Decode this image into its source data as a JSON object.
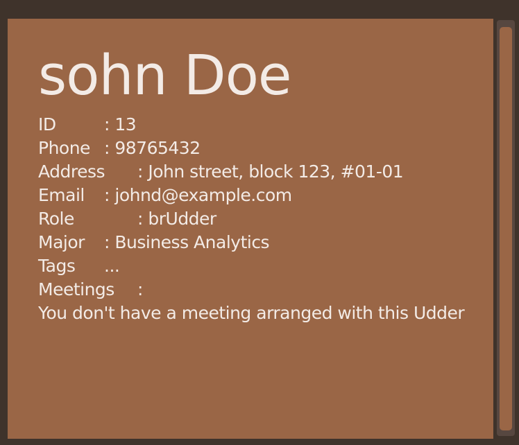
{
  "person": {
    "name": "sohn Doe",
    "fields": [
      {
        "label": "ID",
        "value": ": 13",
        "col": "v1"
      },
      {
        "label": "Phone",
        "value": ": 98765432",
        "col": "v1"
      },
      {
        "label": "Address",
        "value": ": John street, block 123, #01-01",
        "col": "v2"
      },
      {
        "label": "Email",
        "value": ": johnd@example.com",
        "col": "v1"
      },
      {
        "label": "Role",
        "value": ": brUdder",
        "col": "v2"
      },
      {
        "label": "Major",
        "value": ": Business Analytics",
        "col": "v1"
      },
      {
        "label": "Tags",
        "value": "...",
        "col": "v1"
      },
      {
        "label": "Meetings",
        "value": ":",
        "col": "v2"
      }
    ],
    "meeting_note": "You don't have a meeting arranged with this Udder"
  },
  "colors": {
    "panel": "#9a6646",
    "frame": "#3f332b",
    "text": "#f3ebe6"
  }
}
